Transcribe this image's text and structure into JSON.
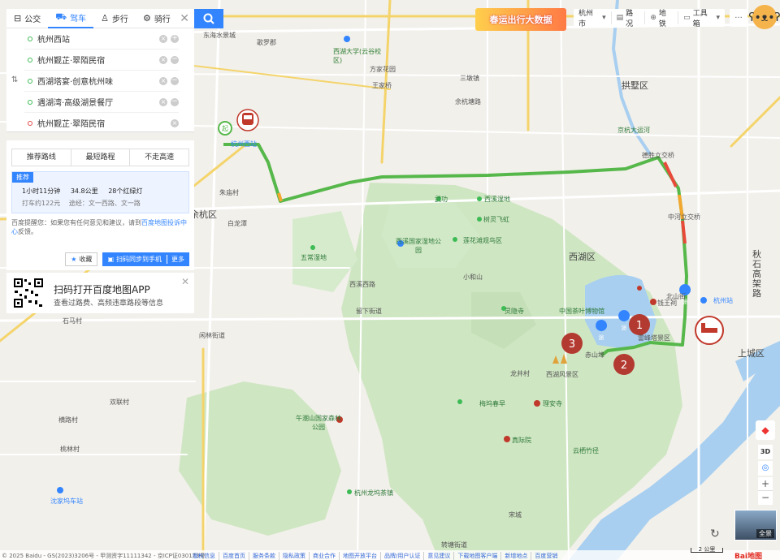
{
  "tabs": [
    {
      "label": "公交",
      "icon": "bus-icon"
    },
    {
      "label": "驾车",
      "icon": "car-icon"
    },
    {
      "label": "步行",
      "icon": "walk-icon"
    },
    {
      "label": "骑行",
      "icon": "bike-icon"
    }
  ],
  "waypoints": [
    {
      "name": "杭州西站",
      "kind": "start"
    },
    {
      "name": "杭州觐芷·翠陌民宿",
      "kind": "via"
    },
    {
      "name": "西湖塔宴·创意杭州味",
      "kind": "via"
    },
    {
      "name": "遇湖湾·高级湖景餐厅",
      "kind": "via"
    },
    {
      "name": "杭州觐芷·翠陌民宿",
      "kind": "end"
    }
  ],
  "route_tabs": [
    "推荐路线",
    "最短路程",
    "不走高速"
  ],
  "route": {
    "badge": "推荐",
    "time": "1小时11分钟",
    "distance": "34.8公里",
    "lights": "28个红绿灯",
    "taxi": "打车约122元",
    "via": "途经：文一西路、文一路"
  },
  "tip": {
    "text": "百度提醒您：如果您有任何意见和建议，请到",
    "link": "百度地图投诉中心",
    "suffix": "反馈。"
  },
  "actions": {
    "fav": "收藏",
    "send": "扫码同步到手机",
    "more": "更多"
  },
  "qr": {
    "title": "扫码打开百度地图APP",
    "sub": "查看过路费、高频违章路段等信息"
  },
  "banner": "春运出行大数据",
  "toolbar": [
    {
      "label": "杭州市",
      "icon": "chevron-down-icon"
    },
    {
      "label": "路况",
      "icon": "traffic-icon"
    },
    {
      "label": "地铁",
      "icon": "subway-icon"
    },
    {
      "label": "工具箱",
      "icon": "toolbox-icon"
    }
  ],
  "controls": {
    "btn3d": "3D",
    "pano": "全景",
    "scale": "2 公里",
    "zoom_in": "+",
    "zoom_out": "−"
  },
  "footer": {
    "copyright": "© 2025 Baidu - GS(2023)3206号 - 甲测资字11111342 - 京ICP证030173号",
    "links": [
      "版权信息",
      "百度首页",
      "服务条款",
      "隐私政策",
      "商业合作",
      "地图开放平台",
      "品牌/用户认证",
      "意见建议",
      "下载地图客户端",
      "新增地点",
      "百度营销"
    ],
    "logo": "Bai地图"
  },
  "map_labels": {
    "big": [
      "余杭区",
      "拱墅区",
      "西湖区",
      "上城区",
      "秋石高架路"
    ],
    "places": [
      "东海水景城",
      "歌罗郡",
      "西湖大学(云谷校区)",
      "王家桥",
      "方家花园",
      "三墩镇",
      "余杭塘路",
      "杭州西站",
      "朱庙村",
      "白龙潭",
      "武功",
      "西溪湿地",
      "西溪国家湿地公园",
      "五常湿地",
      "树灵飞虹",
      "莲花滩观鸟区",
      "西溪西路",
      "中国茶叶博物馆",
      "云栖竹径",
      "梅坞春早",
      "真际院",
      "理安寺",
      "杭州站",
      "钱王祠",
      "雷峰塔景区",
      "赤山埠",
      "西湖风景区",
      "龙井村",
      "灵隐寺",
      "午潮山国家森林公园",
      "杭州龙坞茶镇",
      "转塘街道",
      "沈家坞车站",
      "闲林街道",
      "石马村",
      "双联村",
      "横路村",
      "桃林村",
      "宋城",
      "小和山",
      "留下街道",
      "北山街",
      "德胜立交桥",
      "京杭大运河",
      "中河立交桥"
    ]
  }
}
